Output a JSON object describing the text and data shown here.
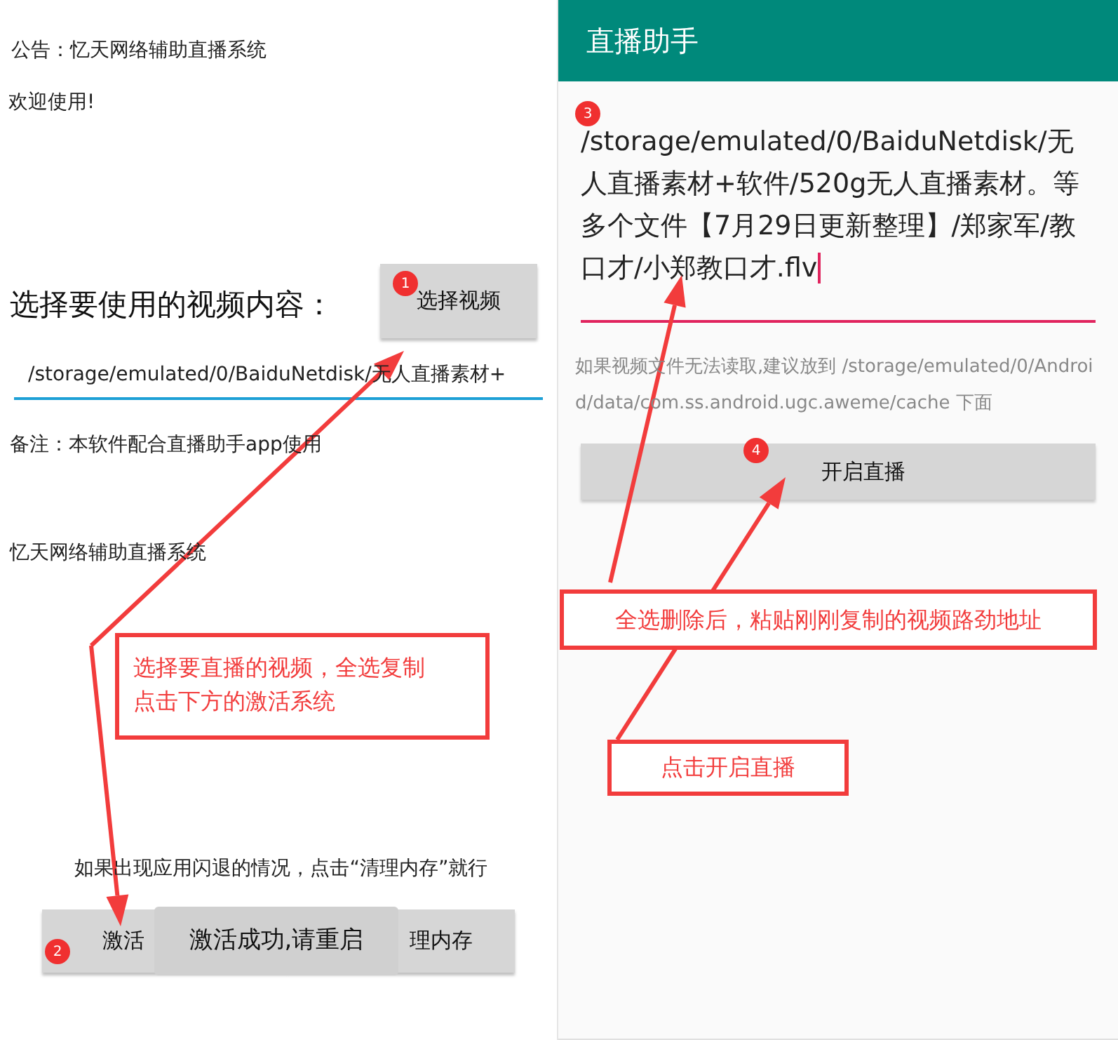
{
  "left_screen": {
    "notice": "公告：忆天网络辅助直播系统",
    "welcome": "欢迎使用!",
    "video_label": "选择要使用的视频内容：",
    "select_button": "选择视频",
    "path_field": {
      "value": "/storage/emulated/0/BaiduNetdisk/无人直播素材+"
    },
    "remark": "备注：本软件配合直播助手app使用",
    "footer_title": "忆天网络辅助直播系统",
    "tip": "如果出现应用闪退的情况，点击“清理内存”就行",
    "buttons": [
      {
        "label": "激活"
      },
      {
        "label": "理内存"
      }
    ],
    "toast": "激活成功,请重启"
  },
  "right_screen": {
    "title": "直播助手",
    "path_input": {
      "value": "/storage/emulated/0/BaiduNetdisk/无人直播素材+软件/520g无人直播素材。等多个文件【7月29日更新整理】/郑家军/教口才/小郑教口才.flv"
    },
    "hint": "如果视频文件无法读取,建议放到 /storage/emulated/0/Android/data/com.ss.android.ugc.aweme/cache 下面",
    "start_button": "开启直播"
  },
  "annotations": {
    "markers": [
      "1",
      "2",
      "3",
      "4"
    ],
    "notes": [
      "选择要直播的视频，全选复制点击下方的激活系统",
      "全选删除后，粘贴刚刚复制的视频路劲地址",
      "点击开启直播"
    ]
  }
}
